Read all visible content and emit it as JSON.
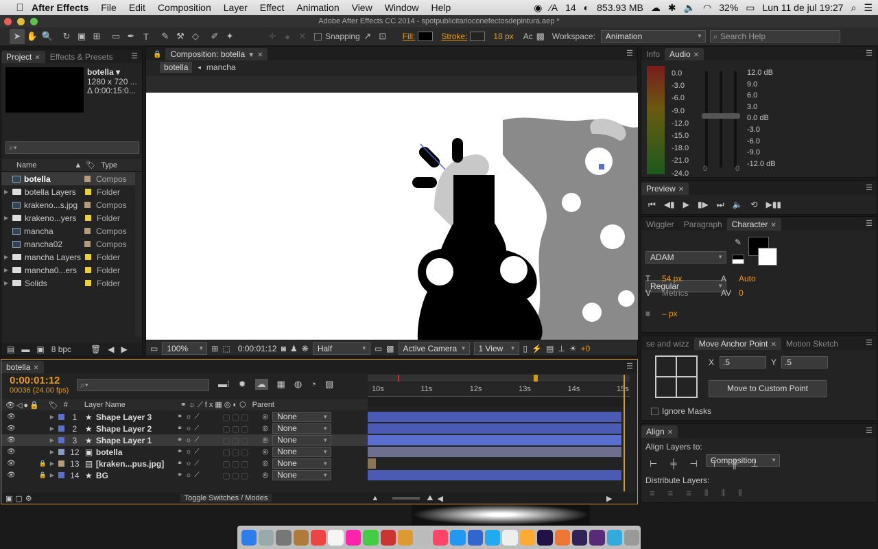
{
  "menubar": {
    "app": "After Effects",
    "items": [
      "File",
      "Edit",
      "Composition",
      "Layer",
      "Effect",
      "Animation",
      "View",
      "Window",
      "Help"
    ],
    "status": {
      "a": "14",
      "mem": "853.93 MB",
      "battery": "32%",
      "clock": "Lun 11 de jul  19:27"
    }
  },
  "window_title": "Adobe After Effects CC 2014 - spotpublicitarioconefectosdepintura.aep *",
  "toolbar": {
    "snapping": "Snapping",
    "fill": "Fill:",
    "stroke": "Stroke:",
    "stroke_px": "18 px",
    "ac": "Ac",
    "workspace_label": "Workspace:",
    "workspace": "Animation",
    "search_placeholder": "Search Help"
  },
  "project": {
    "tab_project": "Project",
    "tab_effects": "Effects & Presets",
    "selected_name": "botella ▾",
    "selected_dims": "1280 x 720  ...",
    "selected_dur": "Δ 0:00:15:0...",
    "bpc": "8 bpc",
    "col_name": "Name",
    "col_type": "Type",
    "items": [
      {
        "name": "botella",
        "type": "Compos",
        "color": "#b79a77",
        "kind": "comp",
        "sel": true
      },
      {
        "name": "botella Layers",
        "type": "Folder",
        "color": "#e8d23a",
        "kind": "folder"
      },
      {
        "name": "krakeno...s.jpg",
        "type": "Compos",
        "color": "#b79a77",
        "kind": "comp"
      },
      {
        "name": "krakeno...yers",
        "type": "Folder",
        "color": "#e8d23a",
        "kind": "folder"
      },
      {
        "name": "mancha",
        "type": "Compos",
        "color": "#b79a77",
        "kind": "comp"
      },
      {
        "name": "mancha02",
        "type": "Compos",
        "color": "#b79a77",
        "kind": "comp"
      },
      {
        "name": "mancha Layers",
        "type": "Folder",
        "color": "#e8d23a",
        "kind": "folder"
      },
      {
        "name": "mancha0...ers",
        "type": "Folder",
        "color": "#e8d23a",
        "kind": "folder"
      },
      {
        "name": "Solids",
        "type": "Folder",
        "color": "#e8d23a",
        "kind": "folder"
      }
    ]
  },
  "comp": {
    "tab": "Composition: botella",
    "crumb1": "botella",
    "crumb2": "mancha",
    "zoom": "100%",
    "time": "0:00:01:12",
    "res": "Half",
    "camera": "Active Camera",
    "views": "1 View",
    "plus": "+0"
  },
  "audio": {
    "tab_info": "Info",
    "tab_audio": "Audio",
    "left_scale": [
      "0.0",
      "-3.0",
      "-6.0",
      "-9.0",
      "-12.0",
      "-15.0",
      "-18.0",
      "-21.0",
      "-24.0"
    ],
    "right_scale": [
      "12.0 dB",
      "9.0",
      "6.0",
      "3.0",
      "0.0 dB",
      "-3.0",
      "-6.0",
      "-9.0",
      "-12.0 dB"
    ],
    "zero_l": "0",
    "zero_r": "0"
  },
  "preview": {
    "tab": "Preview"
  },
  "character": {
    "tab_wiggler": "Wiggler",
    "tab_paragraph": "Paragraph",
    "tab_character": "Character",
    "font": "ADAM",
    "style": "Regular",
    "size": "54 px",
    "leading": "Auto",
    "kerning": "Metrics",
    "tracking": "0",
    "stroke_w": "– px"
  },
  "anchor": {
    "tab_prev": "se and wizz",
    "tab": "Move Anchor Point",
    "tab_next": "Motion Sketch",
    "x_label": "X",
    "x": ".5",
    "y_label": "Y",
    "y": ".5",
    "button": "Move to Custom Point",
    "ignore": "Ignore Masks"
  },
  "align": {
    "tab": "Align",
    "label": "Align Layers to:",
    "target": "Composition",
    "distribute": "Distribute Layers:"
  },
  "timeline": {
    "tab": "botella",
    "timecode": "0:00:01:12",
    "frames": "00036 (24.00 fps)",
    "col_num": "#",
    "col_name": "Layer Name",
    "col_parent": "Parent",
    "toggle": "Toggle Switches / Modes",
    "ticks": [
      "10s",
      "11s",
      "12s",
      "13s",
      "14s",
      "15s"
    ],
    "layers": [
      {
        "num": "1",
        "name": "Shape Layer 3",
        "parent": "None",
        "color": "#5a6ed8",
        "kind": "star",
        "bar": "#4b5bb3"
      },
      {
        "num": "2",
        "name": "Shape Layer 2",
        "parent": "None",
        "color": "#5a6ed8",
        "kind": "star",
        "bar": "#4b5bb3"
      },
      {
        "num": "3",
        "name": "Shape Layer 1",
        "parent": "None",
        "color": "#5a6ed8",
        "kind": "star",
        "bar": "#5a6ed0",
        "sel": true
      },
      {
        "num": "12",
        "name": "botella",
        "parent": "None",
        "color": "#8899cc",
        "kind": "comp",
        "bar": "#6d6f8f"
      },
      {
        "num": "13",
        "name": "[kraken...pus.jpg]",
        "parent": "None",
        "color": "#b79a77",
        "kind": "img",
        "bar": "#2a2a2a",
        "lock": true
      },
      {
        "num": "14",
        "name": "BG",
        "parent": "None",
        "color": "#5a6ed8",
        "kind": "star",
        "bar": "#4b5bb3",
        "lock": true
      }
    ]
  },
  "dock": {
    "colors": [
      "#2d7ee8",
      "#9aa",
      "#777",
      "#b07a3a",
      "#e44",
      "#f5f5f5",
      "#f2a",
      "#4c4",
      "#c33",
      "#d93",
      "#bbb",
      "#f46",
      "#29e",
      "#36c",
      "#2ae",
      "#eee",
      "#fa3",
      "#214",
      "#e73",
      "#325",
      "#5a2a7a",
      "#3ad",
      "#999"
    ]
  }
}
